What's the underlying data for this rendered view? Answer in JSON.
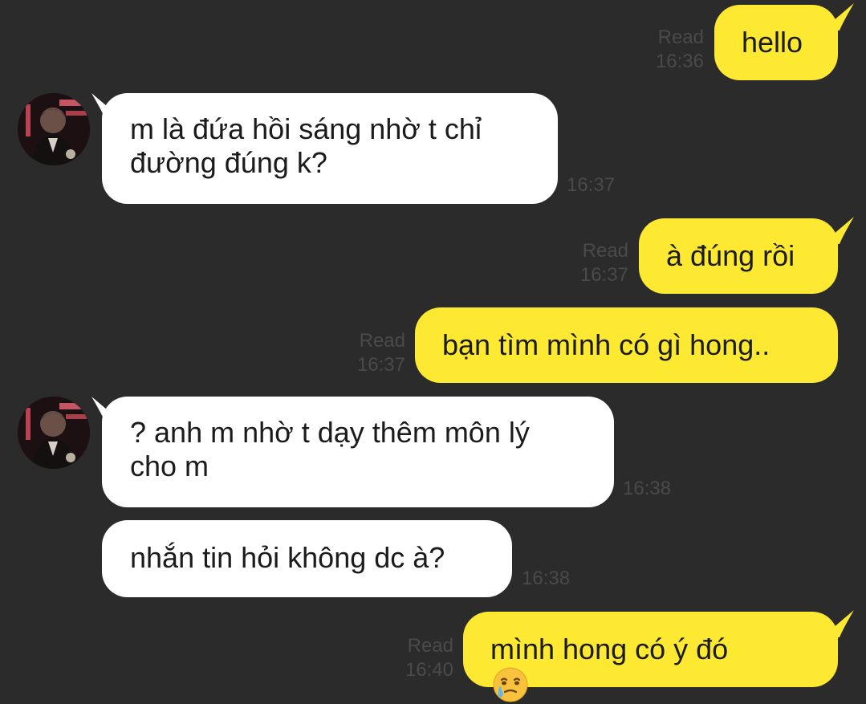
{
  "messages": [
    {
      "id": "m1",
      "dir": "out",
      "text": "hello",
      "status": "Read",
      "time": "16:36"
    },
    {
      "id": "m2",
      "dir": "in",
      "lines": [
        "m là đứa hồi sáng nhờ t chỉ",
        "đường đúng k?"
      ],
      "time": "16:37"
    },
    {
      "id": "m3",
      "dir": "out",
      "text": "à đúng rồi",
      "status": "Read",
      "time": "16:37"
    },
    {
      "id": "m4",
      "dir": "out",
      "text": "bạn tìm mình có gì hong..",
      "status": "Read",
      "time": "16:37"
    },
    {
      "id": "m5",
      "dir": "in",
      "lines": [
        "? anh m nhờ t dạy thêm môn lý",
        "cho m"
      ],
      "time": "16:38"
    },
    {
      "id": "m6",
      "dir": "in",
      "text": "nhắn tin hỏi không dc à?",
      "time": "16:38"
    },
    {
      "id": "m7",
      "dir": "out",
      "text": "mình hong có ý đó",
      "emoji": "face-holding-back-tears",
      "status": "Read",
      "time": "16:40"
    }
  ],
  "colors": {
    "background": "#2b2b2b",
    "outgoing_bubble": "#fde832",
    "incoming_bubble": "#ffffff",
    "meta_text": "#4a4a4a"
  }
}
